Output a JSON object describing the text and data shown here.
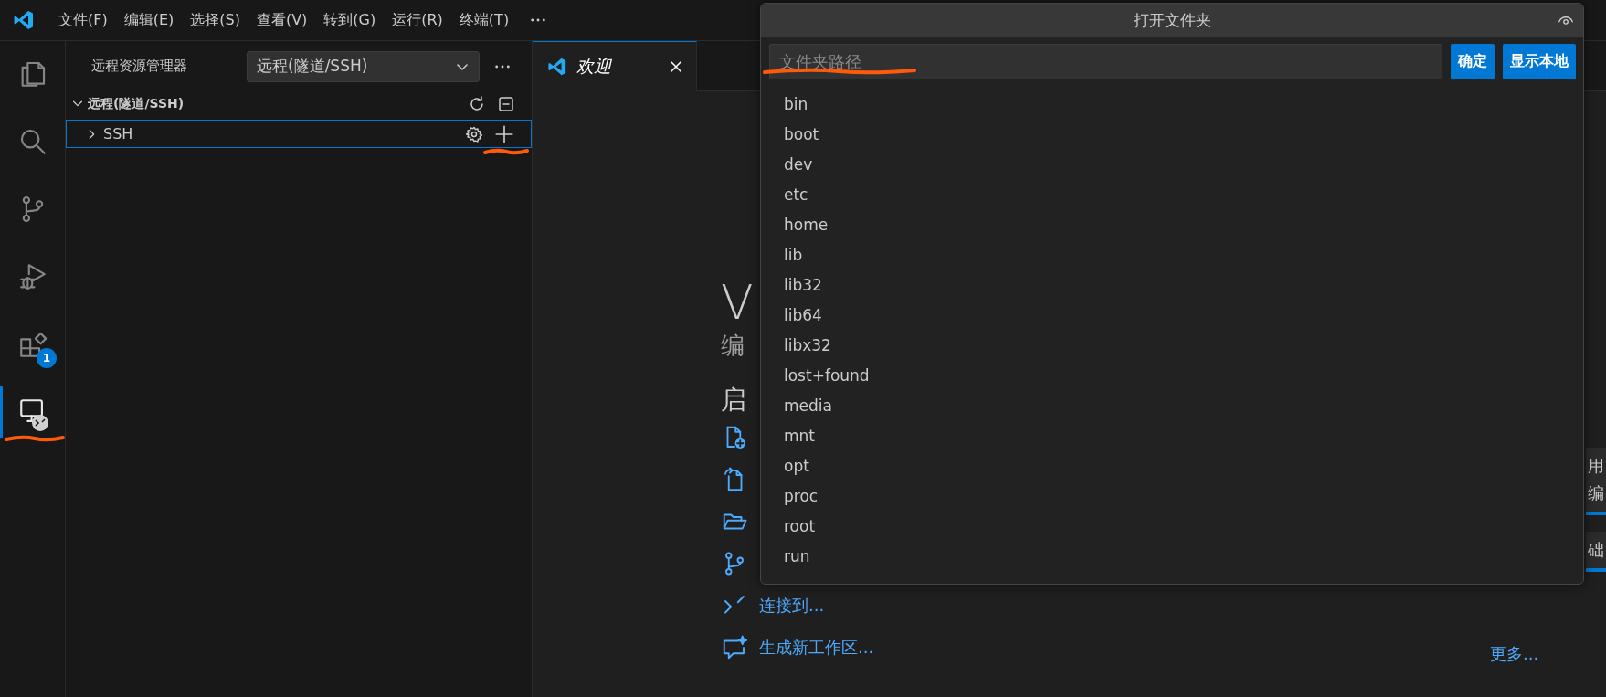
{
  "title_bar": {
    "menus": [
      "文件(F)",
      "编辑(E)",
      "选择(S)",
      "查看(V)",
      "转到(G)",
      "运行(R)",
      "终端(T)"
    ]
  },
  "activity_bar": {
    "items": [
      {
        "kind": "explorer",
        "selected": false,
        "highlighted": false
      },
      {
        "kind": "search",
        "selected": false,
        "highlighted": false
      },
      {
        "kind": "source-control",
        "selected": false,
        "highlighted": false
      },
      {
        "kind": "run-debug",
        "selected": false,
        "highlighted": false
      },
      {
        "kind": "extensions",
        "selected": false,
        "highlighted": false,
        "badge": "1"
      },
      {
        "kind": "remote",
        "selected": true,
        "highlighted": true
      }
    ]
  },
  "sidebar": {
    "title": "远程资源管理器",
    "dropdown": {
      "value": "远程(隧道/SSH)"
    },
    "section": {
      "title": "远程(隧道/SSH)",
      "expanded": true,
      "items": [
        {
          "label": "SSH",
          "expanded": false,
          "selected": true,
          "add_highlighted": true
        }
      ]
    }
  },
  "editor": {
    "tabs": [
      {
        "label": "欢迎",
        "selected": true
      }
    ],
    "welcome": {
      "title": "V",
      "subtitle": "编",
      "start_heading": "启",
      "start_items": [
        {
          "kind": "new-file"
        },
        {
          "kind": "open-file"
        },
        {
          "kind": "open-folder"
        },
        {
          "kind": "clone"
        },
        {
          "kind": "connect",
          "label": "连接到..."
        },
        {
          "kind": "workspace",
          "label": "生成新工作区..."
        }
      ],
      "more_link": "更多...",
      "walkthroughs": [
        {
          "lines": [
            "用",
            "编"
          ]
        },
        {
          "lines": [
            "础"
          ]
        }
      ]
    }
  },
  "dialog": {
    "title": "打开文件夹",
    "path_field": {
      "placeholder": "文件夹路径",
      "highlighted": true
    },
    "buttons": [
      "确定",
      "显示本地"
    ],
    "folders": [
      "bin",
      "boot",
      "dev",
      "etc",
      "home",
      "lib",
      "lib32",
      "lib64",
      "libx32",
      "lost+found",
      "media",
      "mnt",
      "opt",
      "proc",
      "root",
      "run"
    ]
  }
}
